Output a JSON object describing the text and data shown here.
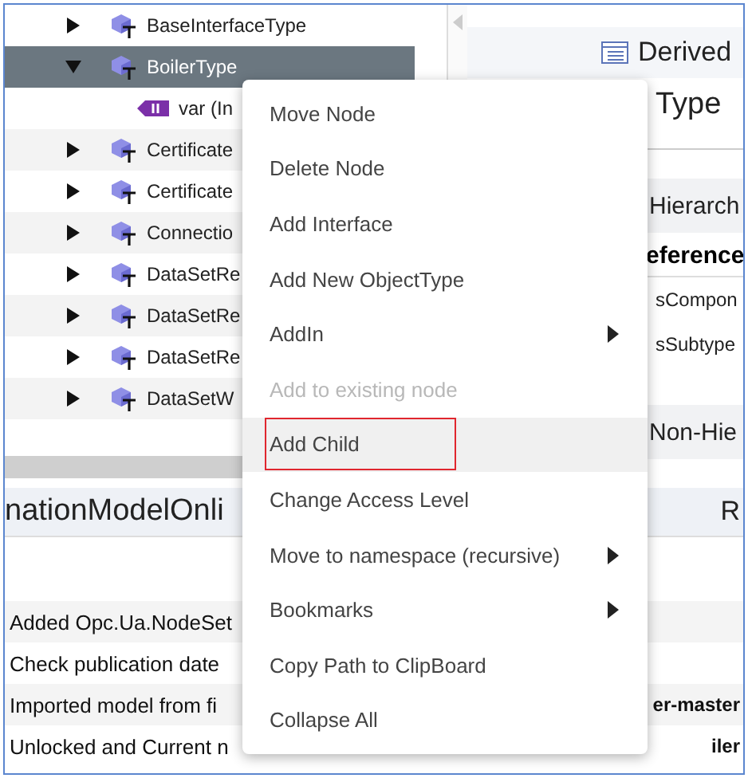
{
  "tree": {
    "rows": [
      {
        "label": "BaseInterfaceType",
        "kind": "object_type",
        "expanded": false,
        "selected": false
      },
      {
        "label": "BoilerType",
        "kind": "object_type",
        "expanded": true,
        "selected": true,
        "children": [
          {
            "label": "var (In",
            "kind": "variable",
            "selected": false
          }
        ]
      },
      {
        "label": "Certificate",
        "kind": "object_type",
        "expanded": false,
        "selected": false
      },
      {
        "label": "Certificate",
        "kind": "object_type",
        "expanded": false,
        "selected": false
      },
      {
        "label": "Connectio",
        "kind": "object_type",
        "expanded": false,
        "selected": false
      },
      {
        "label": "DataSetRe",
        "kind": "object_type",
        "expanded": false,
        "selected": false
      },
      {
        "label": "DataSetRe",
        "kind": "object_type",
        "expanded": false,
        "selected": false
      },
      {
        "label": "DataSetRe",
        "kind": "object_type",
        "expanded": false,
        "selected": false
      },
      {
        "label": "DataSetW",
        "kind": "object_type",
        "expanded": false,
        "selected": false
      }
    ]
  },
  "details": {
    "tab": "Derived",
    "title": "Type",
    "hierarchical_header": "Hierarch",
    "column_header": "eference",
    "rows": [
      "sCompon",
      "sSubtype"
    ],
    "non_hierarchical_header": "Non-Hie"
  },
  "bottom_panel": {
    "title": "nationModelOnli",
    "column_header": "R",
    "log": [
      {
        "message": "Added Opc.Ua.NodeSet"
      },
      {
        "message": "Check publication date"
      },
      {
        "message": "Imported model from fi",
        "detail": "er-master"
      },
      {
        "message": "Unlocked and Current n",
        "detail": "iler"
      }
    ]
  },
  "context_menu": {
    "items": [
      {
        "label": "Move Node",
        "disabled": false,
        "submenu": false,
        "selected": false,
        "outlined": false
      },
      {
        "label": "Delete Node",
        "disabled": false,
        "submenu": false,
        "selected": false,
        "outlined": false
      },
      {
        "label": "Add Interface",
        "disabled": false,
        "submenu": false,
        "selected": false,
        "outlined": false
      },
      {
        "label": "Add New ObjectType",
        "disabled": false,
        "submenu": false,
        "selected": false,
        "outlined": false
      },
      {
        "label": "AddIn",
        "disabled": false,
        "submenu": true,
        "selected": false,
        "outlined": false
      },
      {
        "label": "Add to existing node",
        "disabled": true,
        "submenu": false,
        "selected": false,
        "outlined": false
      },
      {
        "label": "Add Child",
        "disabled": false,
        "submenu": false,
        "selected": true,
        "outlined": true
      },
      {
        "label": "Change Access Level",
        "disabled": false,
        "submenu": false,
        "selected": false,
        "outlined": false
      },
      {
        "label": "Move to namespace (recursive)",
        "disabled": false,
        "submenu": true,
        "selected": false,
        "outlined": false
      },
      {
        "label": "Bookmarks",
        "disabled": false,
        "submenu": true,
        "selected": false,
        "outlined": false
      },
      {
        "label": "Copy Path to ClipBoard",
        "disabled": false,
        "submenu": false,
        "selected": false,
        "outlined": false
      },
      {
        "label": "Collapse All",
        "disabled": false,
        "submenu": false,
        "selected": false,
        "outlined": false
      }
    ]
  }
}
